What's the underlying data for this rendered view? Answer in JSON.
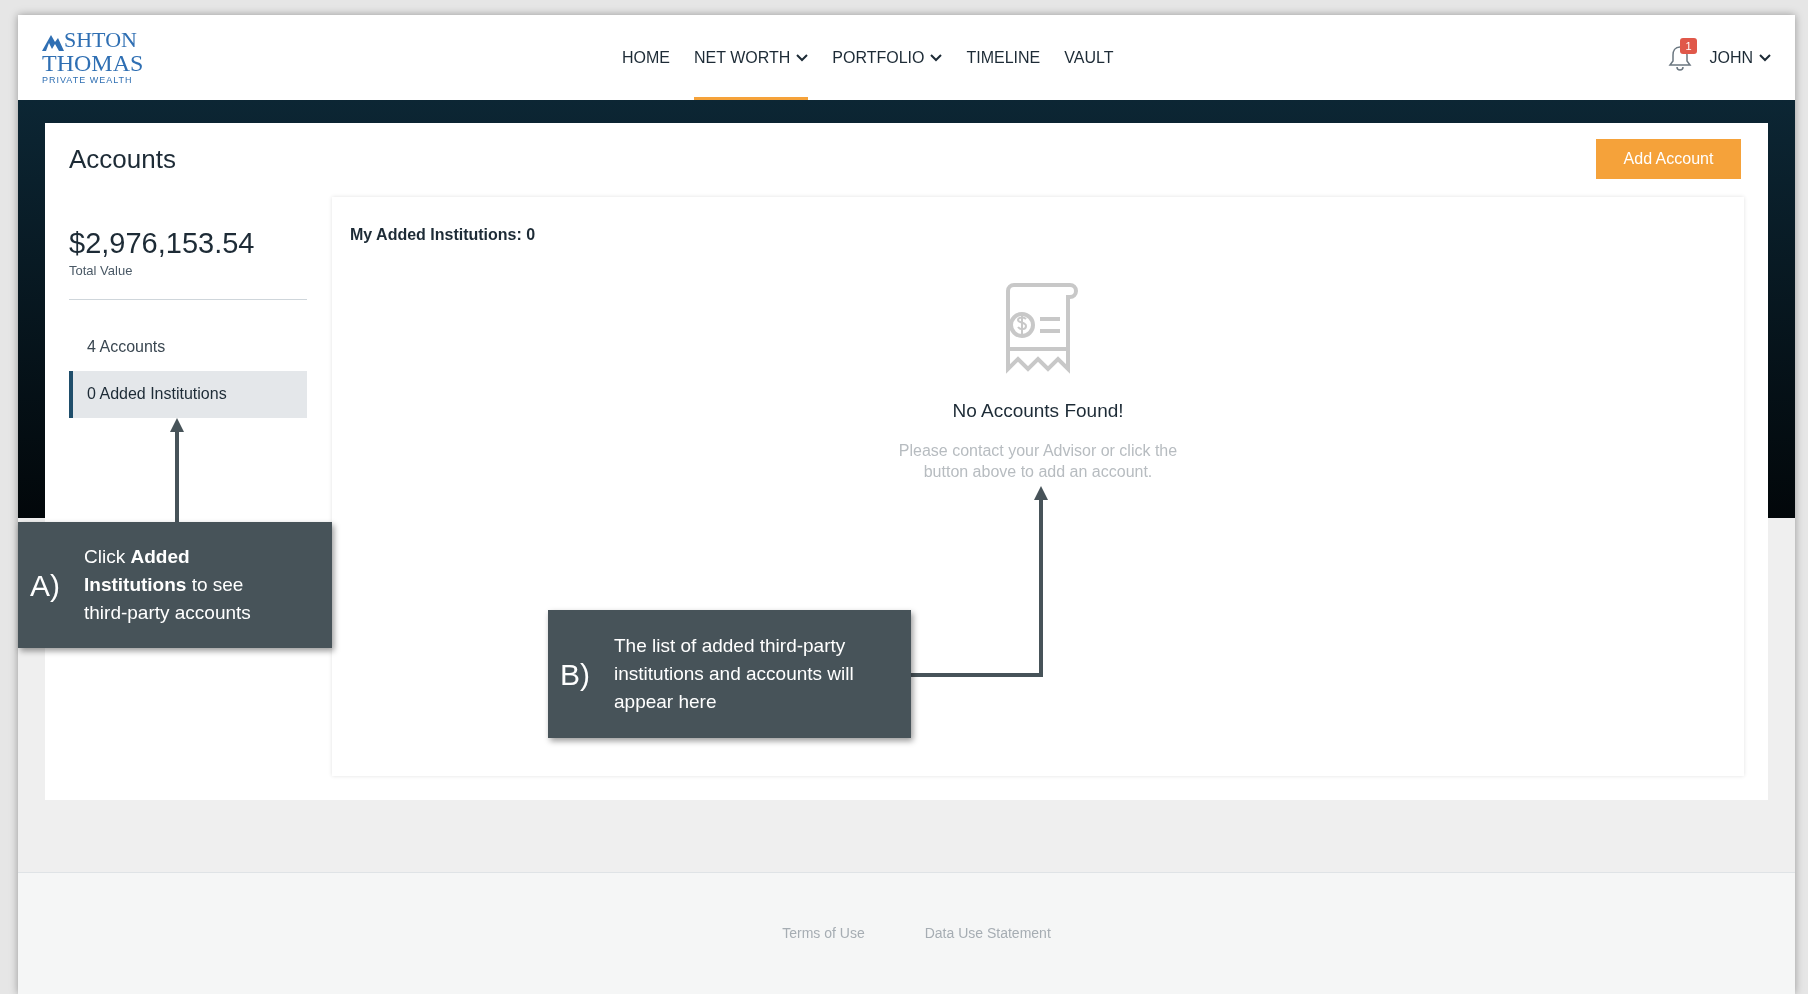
{
  "header": {
    "logo": {
      "line1": "SHTON",
      "line2": "THOMAS",
      "tagline": "PRIVATE WEALTH"
    },
    "nav": [
      {
        "label": "HOME",
        "selected": false,
        "has_menu": false
      },
      {
        "label": "NET WORTH",
        "selected": true,
        "has_menu": true
      },
      {
        "label": "PORTFOLIO",
        "selected": false,
        "has_menu": true
      },
      {
        "label": "TIMELINE",
        "selected": false,
        "has_menu": false
      },
      {
        "label": "VAULT",
        "selected": false,
        "has_menu": false
      }
    ],
    "notifications": {
      "count": "1"
    },
    "user": {
      "name": "JOHN"
    }
  },
  "page": {
    "title": "Accounts",
    "add_button": "Add Account",
    "total": {
      "amount": "$2,976,153.54",
      "label": "Total Value"
    },
    "sidebar": [
      {
        "label": "4 Accounts",
        "selected": false
      },
      {
        "label": "0 Added Institutions",
        "selected": true
      }
    ],
    "panel": {
      "heading": "My Added Institutions: 0",
      "empty_title": "No Accounts Found!",
      "empty_text": "Please contact your Advisor or click the button above to add an account."
    }
  },
  "callouts": [
    {
      "marker": "A)",
      "text": "Click **Added Institutions** to see third-party accounts"
    },
    {
      "marker": "B)",
      "text": "The list of added third-party institutions and accounts will appear here"
    }
  ],
  "footer": {
    "links": [
      "Terms of Use",
      "Data Use Statement"
    ]
  }
}
